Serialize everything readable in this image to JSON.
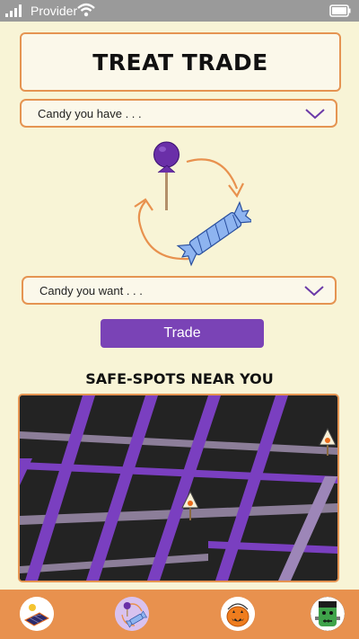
{
  "status_bar": {
    "carrier": "Provider"
  },
  "header": {
    "title": "Treat Trade"
  },
  "trade_form": {
    "have_placeholder": "Candy you have . . .",
    "want_placeholder": "Candy you want . . .",
    "trade_label": "Trade"
  },
  "safe_spots": {
    "heading": "Safe-spots near you"
  },
  "nav": {
    "items": [
      {
        "icon": "solar-panel-icon"
      },
      {
        "icon": "candy-trade-icon"
      },
      {
        "icon": "pumpkin-bucket-icon"
      },
      {
        "icon": "frankenstein-icon"
      }
    ]
  },
  "colors": {
    "accent_orange": "#e59452",
    "accent_purple": "#7a43b6",
    "background": "#f8f4d6",
    "map_dark": "#232323"
  }
}
